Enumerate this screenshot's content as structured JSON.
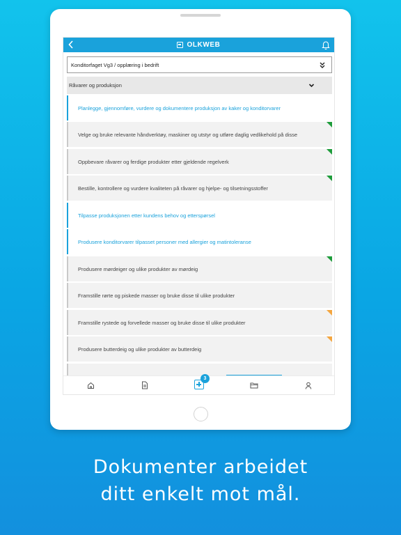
{
  "header": {
    "brand": "OLKWEB",
    "back_icon": "chevron-left-icon",
    "notification_icon": "bell-icon"
  },
  "course_select": {
    "value": "Konditorfaget Vg3 / opplæring i bedrift",
    "icon": "double-chevron-down-icon"
  },
  "category": {
    "label": "Råvarer og produksjon",
    "icon": "chevron-down-icon"
  },
  "items": [
    {
      "type": "goal",
      "label": "Planlegge, gjennomføre, vurdere og dokumentere produksjon av kaker og konditorvarer"
    },
    {
      "type": "sub",
      "label": "Velge og bruke relevante håndverktøy, maskiner og utstyr og utføre daglig vedlikehold på disse",
      "status": "green"
    },
    {
      "type": "sub",
      "label": "Oppbevare råvarer og ferdige produkter etter gjeldende regelverk",
      "status": "green"
    },
    {
      "type": "sub",
      "label": "Bestille, kontrollere og vurdere kvaliteten på råvarer og hjelpe- og tilsetningsstoffer",
      "status": "green"
    },
    {
      "type": "goal",
      "label": "Tilpasse produksjonen etter kundens behov og etterspørsel"
    },
    {
      "type": "goal",
      "label": "Produsere konditorvarer tilpasset personer med allergier og matintoleranse"
    },
    {
      "type": "sub",
      "label": "Produsere mørdeiger og ulike produkter av mørdeig",
      "status": "green"
    },
    {
      "type": "sub",
      "label": "Framstille rørte og piskede masser og bruke disse til ulike produkter",
      "status": ""
    },
    {
      "type": "sub",
      "label": "Framstille rystede og forvellede masser og bruke disse til ulike produkter",
      "status": "orange"
    },
    {
      "type": "sub",
      "label": "Produsere butterdeig og ulike produkter av butterdeig",
      "status": "orange"
    }
  ],
  "tabbar": {
    "home_icon": "home-icon",
    "document_icon": "document-icon",
    "add_icon": "add-icon",
    "badge_count": "3",
    "folder_icon": "folder-icon",
    "profile_icon": "user-icon"
  },
  "tagline": {
    "line1": "Dokumenter arbeidet",
    "line2": "ditt enkelt mot mål."
  },
  "colors": {
    "accent": "#1aa2db",
    "status_green": "#1e9c3b",
    "status_orange": "#f4a640"
  }
}
